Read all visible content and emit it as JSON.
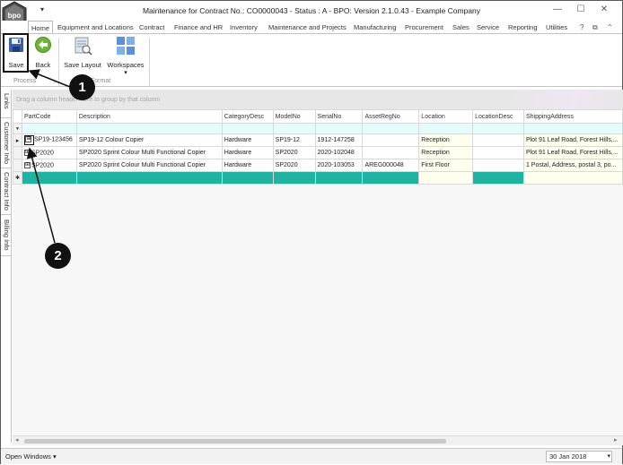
{
  "window": {
    "title": "Maintenance for Contract No.: CO0000043 - Status : A - BPO: Version 2.1.0.43 - Example Company",
    "logo_text": "bpo",
    "qat_arrow": "▾",
    "minimize": "—",
    "maximize": "☐",
    "close": "✕"
  },
  "tabs": [
    "Home",
    "Equipment and Locations",
    "Contract",
    "Finance and HR",
    "Inventory",
    "Maintenance and Projects",
    "Manufacturing",
    "Procurement",
    "Sales",
    "Service",
    "Reporting",
    "Utilities"
  ],
  "tab_controls": {
    "help": "?",
    "restore": "⧉",
    "collapse": "⌃"
  },
  "ribbon": {
    "save_label": "Save",
    "back_label": "Back",
    "save_layout_label": "Save Layout",
    "workspaces_label": "Workspaces",
    "workspaces_arrow": "▾",
    "process_group": "Process",
    "format_group": "Format"
  },
  "side_tabs": [
    "Links",
    "Customer Info",
    "Contract Info",
    "Billing Info"
  ],
  "grid": {
    "group_hint": "Drag a column header here to group by that column",
    "filter_icon": "▼",
    "columns": [
      "PartCode",
      "Description",
      "CategoryDesc",
      "ModelNo",
      "SerialNo",
      "AssetRegNo",
      "Location",
      "LocationDesc",
      "ShippingAddress"
    ],
    "rows": [
      {
        "indicator": "▸",
        "expander": "⊞",
        "PartCode": "SP19-123456",
        "Description": "SP19-12 Colour Copier",
        "CategoryDesc": "Hardware",
        "ModelNo": "SP19-12",
        "SerialNo": "1912-147258",
        "AssetRegNo": "",
        "Location": "Reception",
        "LocationDesc": "",
        "ShippingAddress": "Plot 91 Leaf Road, Forest Hills,..."
      },
      {
        "indicator": "",
        "expander": "⊞",
        "PartCode": "SP2020",
        "Description": "SP2020 Sprint Colour Multi Functional Copier",
        "CategoryDesc": "Hardware",
        "ModelNo": "SP2020",
        "SerialNo": "2020-102048",
        "AssetRegNo": "",
        "Location": "Reception",
        "LocationDesc": "",
        "ShippingAddress": "Plot 91 Leaf Road, Forest Hills,..."
      },
      {
        "indicator": "",
        "expander": "⊞",
        "PartCode": "SP2020",
        "Description": "SP2020 Sprint Colour Multi Functional Copier",
        "CategoryDesc": "Hardware",
        "ModelNo": "SP2020",
        "SerialNo": "2020-103053",
        "AssetRegNo": "AREG000048",
        "Location": "First Floor",
        "LocationDesc": "",
        "ShippingAddress": "1 Postal, Address, postal 3, po..."
      }
    ],
    "new_row_indicator": "✱"
  },
  "scrollbar": {
    "left_arrow": "◂",
    "right_arrow": "▸"
  },
  "statusbar": {
    "open_windows": "Open Windows ▾",
    "date": "30 Jan 2018",
    "date_drop": "▾"
  },
  "callouts": {
    "one": "1",
    "two": "2"
  },
  "colors": {
    "new_row": "#21b3a1",
    "filter_row": "#e6fbfc",
    "editable_cell": "#fffff0"
  }
}
